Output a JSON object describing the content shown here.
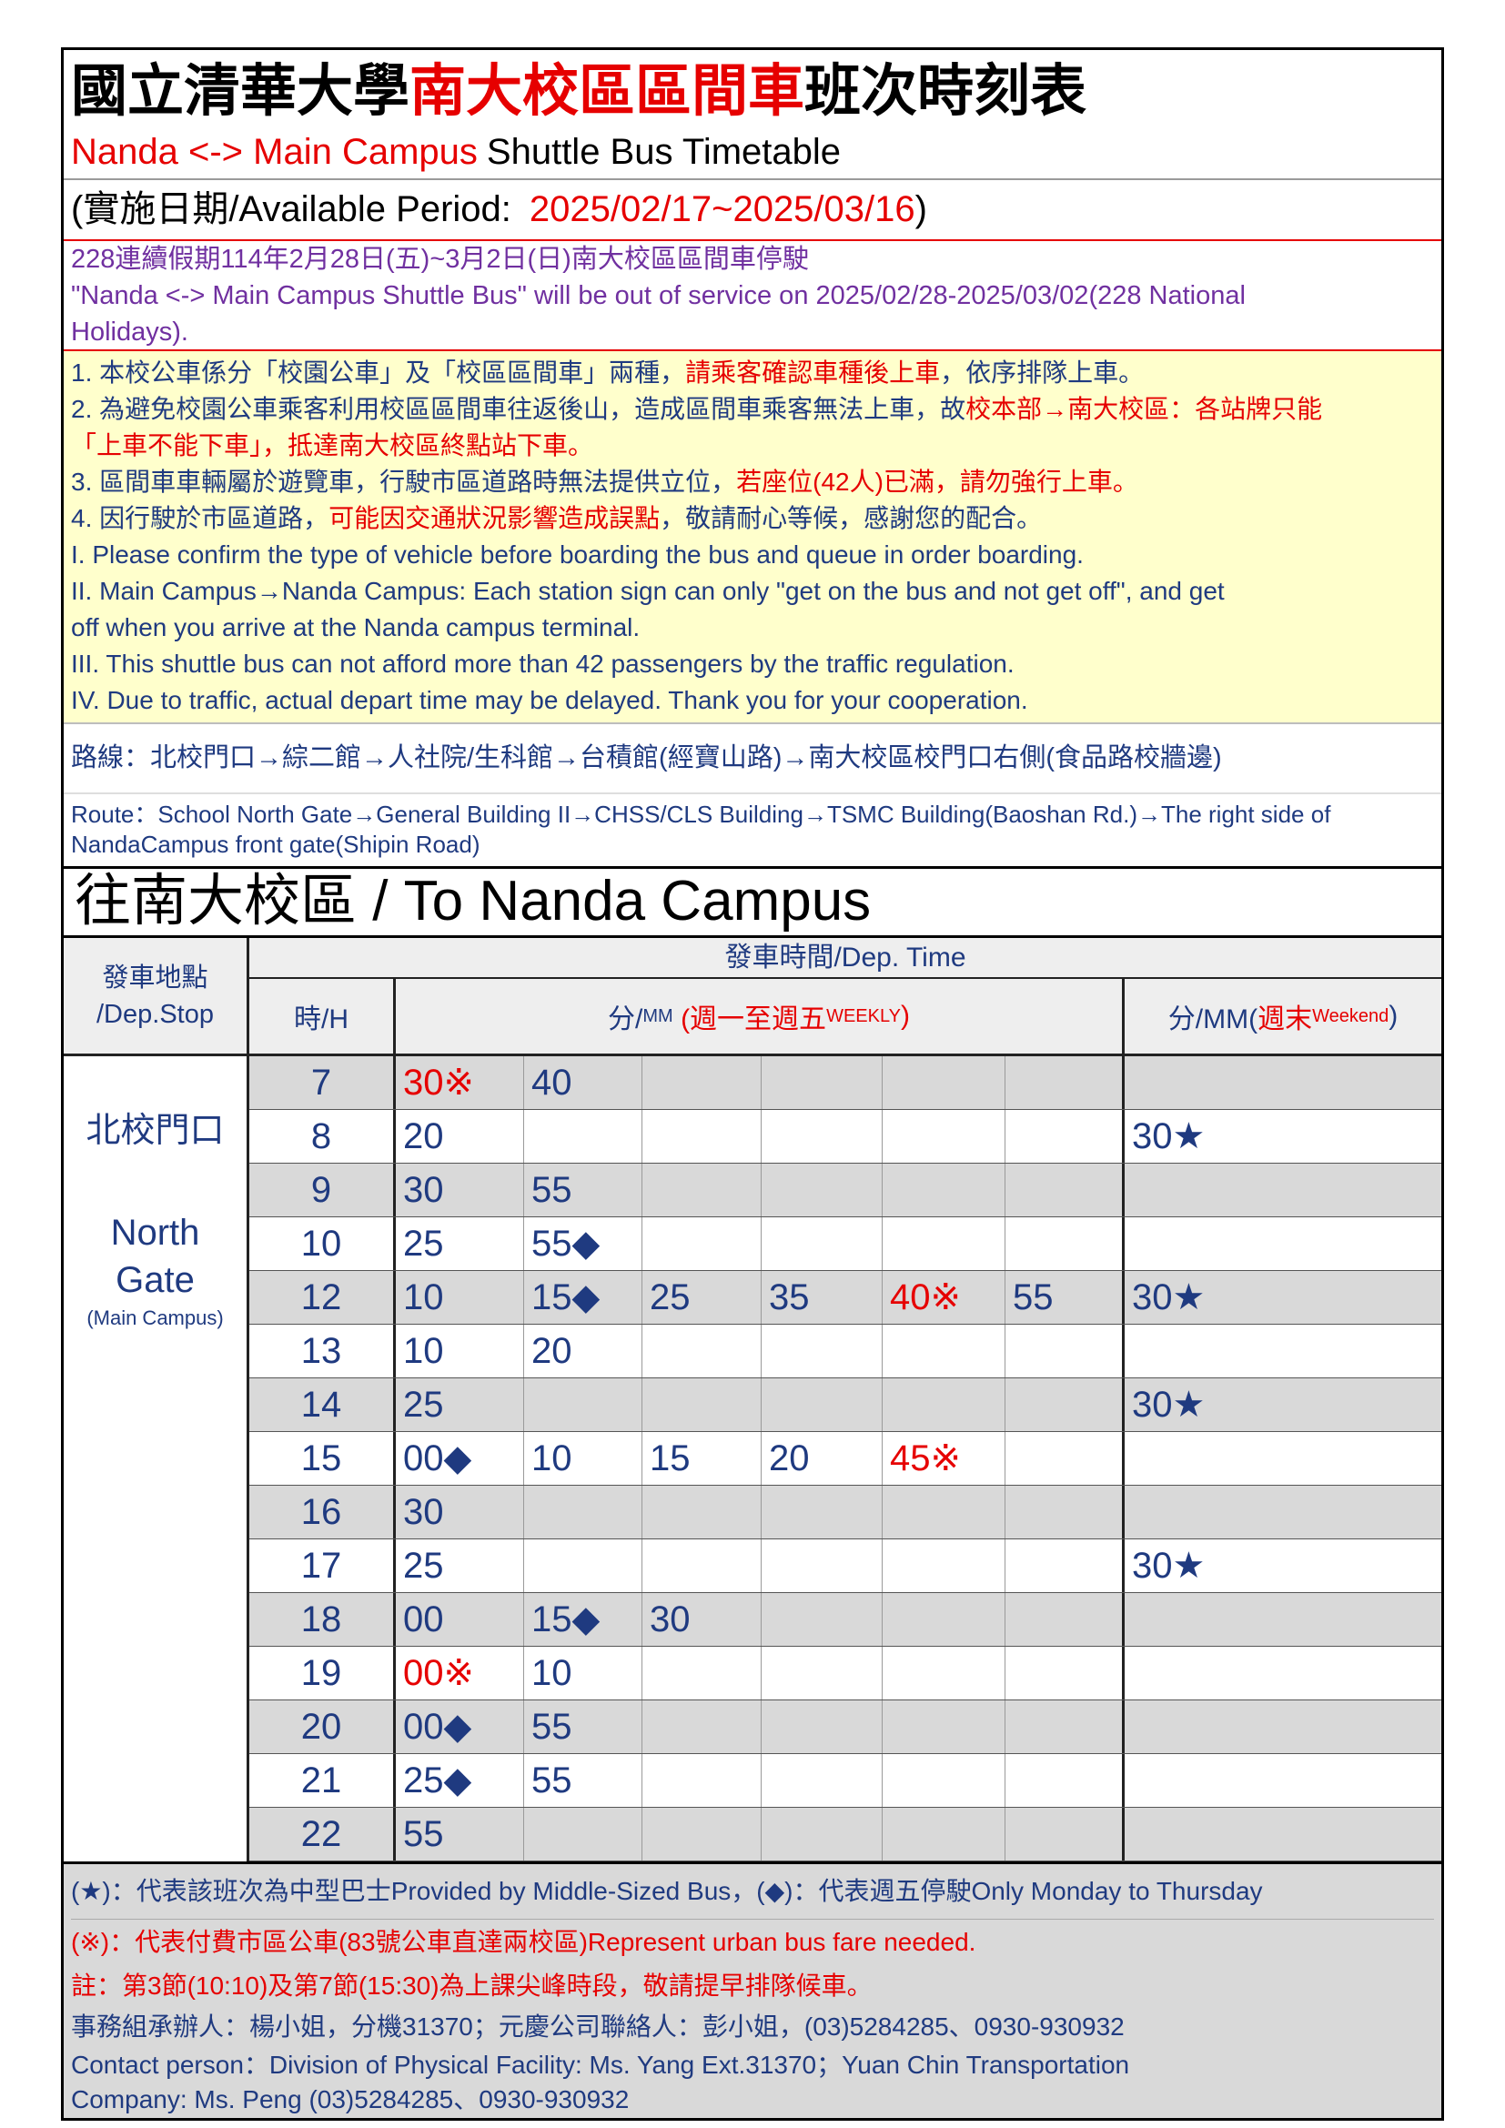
{
  "colors": {
    "blue": "#1f3a80",
    "red": "#e60000",
    "purple": "#7030a0",
    "note_bg": "#ffffcc",
    "row_shade": "#d9d9d9",
    "footer_bg": "#d9d9d9"
  },
  "header": {
    "title_black_1": "國立清華大學",
    "title_red": "南大校區區間車",
    "title_black_2": "班次時刻表",
    "subtitle_red": "Nanda <-> Main Campus",
    "subtitle_black": "Shuttle Bus Timetable"
  },
  "period": {
    "label": "(實施日期/Available Period:",
    "dates": "2025/02/17~2025/03/16",
    "close": ")"
  },
  "holiday_notice": {
    "zh": "228連續假期114年2月28日(五)~3月2日(日)南大校區區間車停駛",
    "en_line1": "\"Nanda <-> Main Campus Shuttle Bus\" will be out of service on 2025/02/28-2025/03/02(228 National",
    "en_line2": "Holidays)."
  },
  "notes": {
    "zh_1": [
      "1. 本校公車係分「校園公車」及「校區區間車」兩種，",
      "請乘客確認車種後上車",
      "，依序排隊上車。"
    ],
    "zh_2": [
      "2. 為避免校園公車乘客利用校區區間車往返後山，造成區間車乘客無法上車，故",
      "校本部→南大校區：各站牌只能"
    ],
    "zh_2_cont": "「上車不能下車」，抵達南大校區終點站下車。",
    "zh_3": [
      "3. 區間車車輛屬於遊覽車，行駛市區道路時無法提供立位，",
      "若座位(42人)已滿，請勿強行上車。"
    ],
    "zh_4": [
      "4. 因行駛於市區道路，",
      "可能因交通狀況影響造成誤點",
      "，敬請耐心等候，感謝您的配合。"
    ],
    "en_1": "I. Please confirm the type of vehicle before boarding the bus and queue in order boarding.",
    "en_2": "II. Main Campus→Nanda Campus: Each station sign can only \"get on the bus and not get off\", and get",
    "en_2_cont": "off when you arrive at the Nanda campus terminal.",
    "en_3": "III. This shuttle bus can not afford more than 42 passengers by the traffic regulation.",
    "en_4": "IV. Due to traffic, actual depart time may be delayed. Thank you for your cooperation."
  },
  "route": {
    "zh": "路線：北校門口→綜二館→人社院/生科館→台積館(經寶山路)→南大校區校門口右側(食品路校牆邊)",
    "en_line1": "Route：School North Gate→General Building II→CHSS/CLS Building→TSMC Building(Baoshan Rd.)→The right side of",
    "en_line2": "NandaCampus front gate(Shipin Road)"
  },
  "section_title": "往南大校區 / To Nanda Campus",
  "table": {
    "stop_header_zh": "發車地點",
    "stop_header_en": "/Dep.Stop",
    "time_header": "發車時間/Dep. Time",
    "hour_header": "時/H",
    "weekday_header": {
      "unit": "分/",
      "unit_small": "MM",
      "days": "(週一至週五",
      "days_small": "WEEKLY",
      "close": ")"
    },
    "weekend_header": {
      "unit": "分/MM(",
      "days": "週末",
      "days_small": "Weekend",
      "close": ")"
    },
    "stop": {
      "zh": "北校門口",
      "en": "North Gate",
      "sub": "(Main Campus)"
    },
    "rows": [
      {
        "hour": "7",
        "weekday": [
          "30※",
          "40"
        ]
      },
      {
        "hour": "8",
        "weekday": [
          "20"
        ],
        "weekend": "30★"
      },
      {
        "hour": "9",
        "weekday": [
          "30",
          "55"
        ]
      },
      {
        "hour": "10",
        "weekday": [
          "25",
          "55◆"
        ]
      },
      {
        "hour": "12",
        "weekday": [
          "10",
          "15◆",
          "25",
          "35",
          "40※",
          "55"
        ],
        "weekend": "30★"
      },
      {
        "hour": "13",
        "weekday": [
          "10",
          "20"
        ]
      },
      {
        "hour": "14",
        "weekday": [
          "25"
        ],
        "weekend": "30★"
      },
      {
        "hour": "15",
        "weekday": [
          "00◆",
          "10",
          "15",
          "20",
          "45※"
        ]
      },
      {
        "hour": "16",
        "weekday": [
          "30"
        ]
      },
      {
        "hour": "17",
        "weekday": [
          "25"
        ],
        "weekend": "30★"
      },
      {
        "hour": "18",
        "weekday": [
          "00",
          "15◆",
          "30"
        ]
      },
      {
        "hour": "19",
        "weekday": [
          "00※",
          "10"
        ]
      },
      {
        "hour": "20",
        "weekday": [
          "00◆",
          "55"
        ]
      },
      {
        "hour": "21",
        "weekday": [
          "25◆",
          "55"
        ]
      },
      {
        "hour": "22",
        "weekday": [
          "55"
        ]
      }
    ]
  },
  "legend": {
    "line1": "(★)：代表該班次為中型巴士Provided by Middle-Sized Bus，(◆)：代表週五停駛Only Monday to Thursday",
    "line2": "(※)：代表付費市區公車(83號公車直達兩校區)Represent urban bus fare needed.",
    "line3": "註：第3節(10:10)及第7節(15:30)為上課尖峰時段，敬請提早排隊候車。",
    "contact_zh": "事務組承辦人：楊小姐，分機31370；元慶公司聯絡人：彭小姐，(03)5284285、0930-930932",
    "contact_en_1": "Contact person：Division of Physical Facility: Ms. Yang  Ext.31370；Yuan Chin Transportation",
    "contact_en_2": "Company: Ms. Peng  (03)5284285、0930-930932"
  }
}
